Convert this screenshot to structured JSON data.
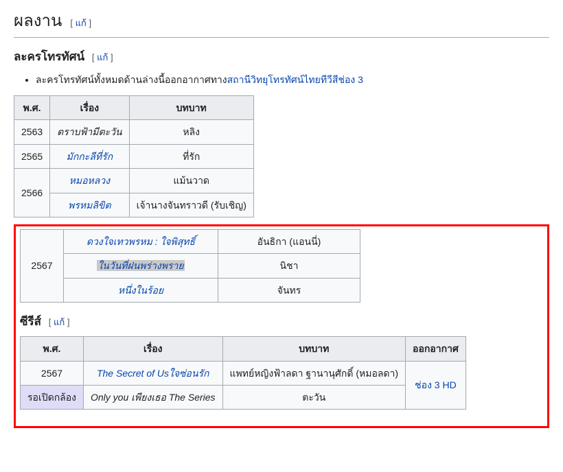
{
  "headings": {
    "works": "ผลงาน",
    "tv": "ละครโทรทัศน์",
    "series": "ซีรีส์"
  },
  "editLabel": "แก้",
  "intro": {
    "prefix": "ละครโทรทัศน์ทั้งหมดด้านล่างนี้ออกอากาศทาง",
    "linkText": "สถานีวิทยุโทรทัศน์ไทยทีวีสีช่อง 3"
  },
  "tvTable": {
    "headers": {
      "year": "พ.ศ.",
      "title": "เรื่อง",
      "role": "บทบาท"
    },
    "rows": [
      {
        "year": "2563",
        "title": "ตราบฟ้ามีตะวัน",
        "role": "หลิง",
        "link": false,
        "yearSpan": 1
      },
      {
        "year": "2565",
        "title": "มักกะลีที่รัก",
        "role": "ที่รัก",
        "link": true,
        "yearSpan": 1
      },
      {
        "year": "2566",
        "title": "หมอหลวง",
        "role": "แม้นวาด",
        "link": true,
        "yearSpan": 2
      },
      {
        "year": "",
        "title": "พรหมลิขิต",
        "role": "เจ้านางจันทราวดี (รับเชิญ)",
        "link": true
      },
      {
        "year": "2567",
        "title": "ดวงใจเทวพรหม : ใจพิสุทธิ์",
        "role": "อันธิกา (แอนนี่)",
        "link": true,
        "yearSpan": 3
      },
      {
        "year": "",
        "title": "ในวันที่ฝนพร่างพราย",
        "role": "นิชา",
        "link": true,
        "highlight": true
      },
      {
        "year": "",
        "title": "หนึ่งในร้อย",
        "role": "จันทร",
        "link": true
      }
    ]
  },
  "seriesTable": {
    "headers": {
      "year": "พ.ศ.",
      "title": "เรื่อง",
      "role": "บทบาท",
      "channel": "ออกอากาศ"
    },
    "rows": [
      {
        "year": "2567",
        "title": "The Secret of Usใจซ่อนรัก",
        "role": "แพทย์หญิงฟ้าลดา ฐานานุศักดิ์ (หมอลดา)",
        "link": true
      },
      {
        "year": "รอเปิดกล้อง",
        "title": "Only you เพียงเธอ The Series",
        "role": "ตะวัน",
        "link": false,
        "yearHighlight": true
      }
    ],
    "channelLink": "ช่อง 3 HD"
  }
}
